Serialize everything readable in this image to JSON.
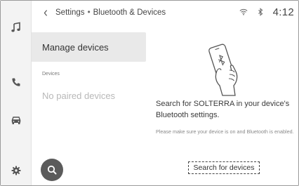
{
  "header": {
    "back_icon": "chevron-left-icon",
    "breadcrumb_parent": "Settings",
    "breadcrumb_separator": "•",
    "breadcrumb_current": "Bluetooth & Devices",
    "clock": "4:12",
    "status_icons": [
      "wifi-icon",
      "bluetooth-icon"
    ]
  },
  "rail": {
    "items": [
      {
        "icon": "music-note-icon"
      },
      {
        "icon": "phone-icon"
      },
      {
        "icon": "car-icon"
      },
      {
        "icon": "gear-icon"
      }
    ]
  },
  "list": {
    "active_item": "Manage devices",
    "section_label": "Devices",
    "empty_message": "No paired devices"
  },
  "content": {
    "illustration": "phone-bluetooth-hand-illustration",
    "main_message": "Search for SOLTERRA in your device's Bluetooth settings.",
    "sub_message": "Please make sure your device is on and Bluetooth is enabled.",
    "search_devices_label": "Search for devices"
  },
  "search_fab_icon": "search-icon"
}
